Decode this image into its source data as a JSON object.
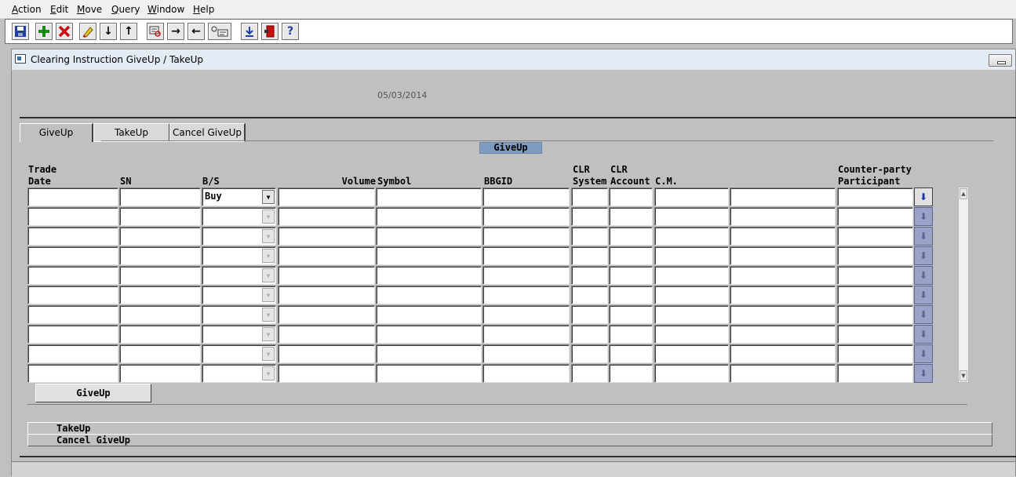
{
  "menu": [
    {
      "label": "Action",
      "mnemonic": "A",
      "rest": "ction"
    },
    {
      "label": "Edit",
      "mnemonic": "E",
      "rest": "dit"
    },
    {
      "label": "Move",
      "mnemonic": "M",
      "rest": "ove"
    },
    {
      "label": "Query",
      "mnemonic": "Q",
      "rest": "uery"
    },
    {
      "label": "Window",
      "mnemonic": "W",
      "rest": "indow"
    },
    {
      "label": "Help",
      "mnemonic": "H",
      "rest": "elp"
    }
  ],
  "toolbar": {
    "icons": [
      "save-icon",
      "add-record-icon",
      "delete-record-icon",
      "edit-icon",
      "next-record-icon",
      "previous-record-icon",
      "query-icon",
      "next-block-icon",
      "previous-block-icon",
      "list-of-values-icon",
      "download-icon",
      "exit-icon",
      "help-icon"
    ],
    "glyphs": {
      "next": "↓",
      "prev": "↑",
      "right": "→",
      "left": "←",
      "help": "?"
    }
  },
  "window": {
    "title": "Clearing Instruction GiveUp / TakeUp",
    "date": "05/03/2014"
  },
  "tabs": [
    {
      "label": "GiveUp",
      "active": true
    },
    {
      "label": "TakeUp",
      "active": false
    },
    {
      "label": "Cancel GiveUp",
      "active": false
    }
  ],
  "section": {
    "title": "GiveUp"
  },
  "columns": {
    "trade_date": "Trade\nDate",
    "sn": "SN",
    "bs": "B/S",
    "volume": "Volume",
    "symbol": "Symbol",
    "bbgid": "BBGID",
    "clr_system": "CLR\nSystem",
    "clr_account": "CLR\nAccount",
    "cm": "C.M.",
    "counterparty": "Counter-party\nParticipant"
  },
  "grid": {
    "row_count": 10,
    "first_row_bs": "Buy",
    "lov_glyph": "⬇",
    "dropdown_glyph": "▼"
  },
  "actions": {
    "giveup_button": "GiveUp",
    "takeup_row": "TakeUp",
    "cancel_giveup_row": "Cancel GiveUp"
  }
}
